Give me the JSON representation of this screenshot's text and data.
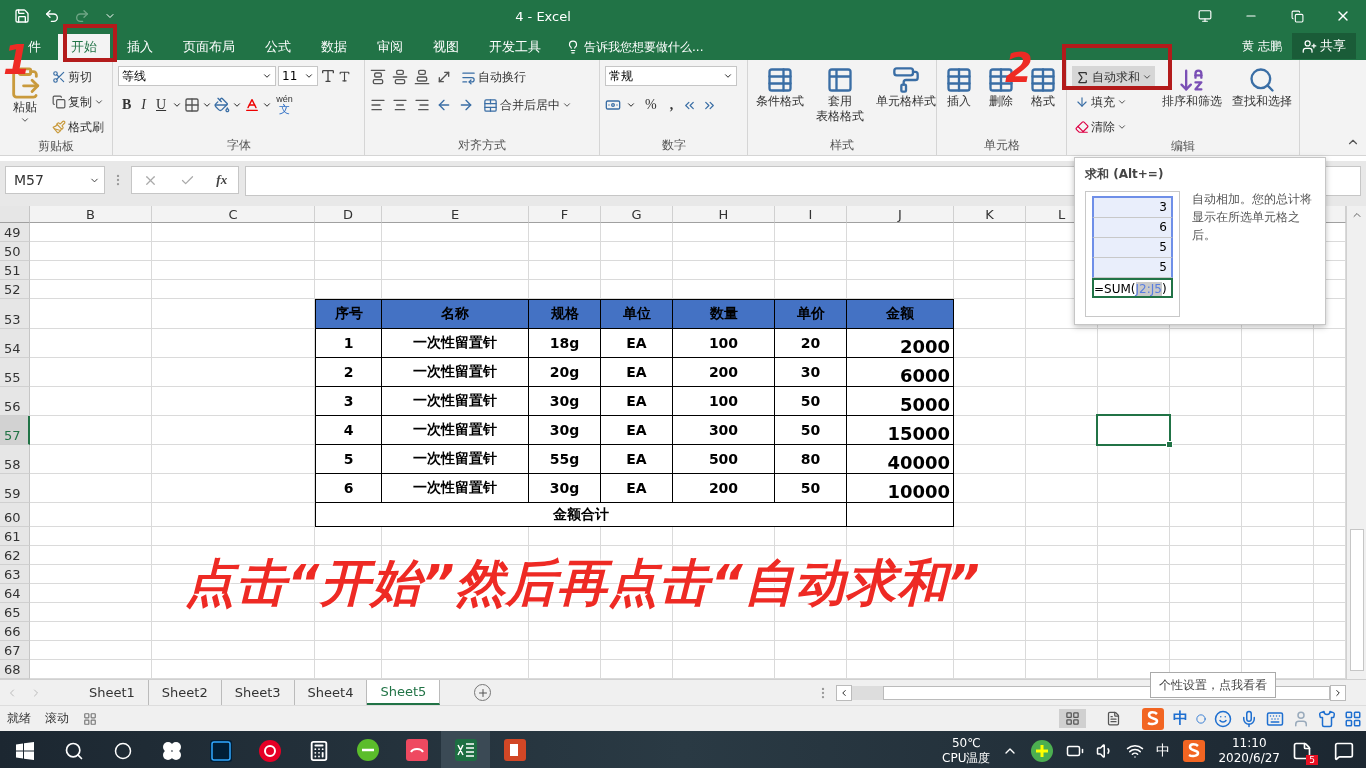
{
  "window": {
    "title": "4 - Excel"
  },
  "ribbon_tabs": [
    {
      "label": "件",
      "selected": false
    },
    {
      "label": "开始",
      "selected": true
    },
    {
      "label": "插入",
      "selected": false
    },
    {
      "label": "页面布局",
      "selected": false
    },
    {
      "label": "公式",
      "selected": false
    },
    {
      "label": "数据",
      "selected": false
    },
    {
      "label": "审阅",
      "selected": false
    },
    {
      "label": "视图",
      "selected": false
    },
    {
      "label": "开发工具",
      "selected": false
    }
  ],
  "tell_me": {
    "placeholder": "告诉我您想要做什么..."
  },
  "account": {
    "user": "黄 志鹏",
    "share": "共享"
  },
  "ribbon": {
    "clipboard": {
      "label": "剪贴板",
      "paste": "粘贴",
      "cut": "剪切",
      "copy": "复制",
      "format_painter": "格式刷"
    },
    "font": {
      "label": "字体",
      "font_name": "等线",
      "font_size": "11",
      "bold": "B",
      "italic": "I",
      "underline": "U",
      "phonetic_top": "wén",
      "phonetic_bottom": "文"
    },
    "alignment": {
      "label": "对齐方式",
      "wrap_text": "自动换行",
      "merge_center": "合并后居中"
    },
    "number": {
      "label": "数字",
      "format": "常规",
      "percent": "%",
      "comma": ","
    },
    "styles": {
      "label": "样式",
      "buttons": [
        {
          "lines": [
            "条件格式"
          ]
        },
        {
          "lines": [
            "套用",
            "表格格式"
          ]
        },
        {
          "lines": [
            "单元格样式"
          ]
        }
      ]
    },
    "cells": {
      "label": "单元格",
      "buttons": [
        "插入",
        "删除",
        "格式"
      ]
    },
    "editing": {
      "label": "编辑",
      "autosum": "自动求和",
      "fill": "填充",
      "clear": "清除",
      "sort_filter": "排序和筛选",
      "find_select": "查找和选择"
    }
  },
  "formula_bar": {
    "name_box": "M57",
    "function_label": "fx"
  },
  "sheet": {
    "columns": [
      "B",
      "C",
      "D",
      "E",
      "F",
      "G",
      "H",
      "I",
      "J",
      "K",
      "L"
    ],
    "rows": [
      {
        "number": "49",
        "selected": false
      },
      {
        "number": "50",
        "selected": false
      },
      {
        "number": "51",
        "selected": false
      },
      {
        "number": "52",
        "selected": false
      },
      {
        "number": "53",
        "selected": false
      },
      {
        "number": "54",
        "selected": false
      },
      {
        "number": "55",
        "selected": false
      },
      {
        "number": "56",
        "selected": false
      },
      {
        "number": "57",
        "selected": true
      },
      {
        "number": "58",
        "selected": false
      },
      {
        "number": "59",
        "selected": false
      },
      {
        "number": "60",
        "selected": false
      },
      {
        "number": "61",
        "selected": false
      },
      {
        "number": "62",
        "selected": false
      },
      {
        "number": "63",
        "selected": false
      },
      {
        "number": "64",
        "selected": false
      },
      {
        "number": "65",
        "selected": false
      },
      {
        "number": "66",
        "selected": false
      },
      {
        "number": "67",
        "selected": false
      },
      {
        "number": "68",
        "selected": false
      }
    ],
    "table": {
      "header": [
        "序号",
        "名称",
        "规格",
        "单位",
        "数量",
        "单价",
        "金额"
      ],
      "rows": [
        [
          "1",
          "一次性留置针",
          "18g",
          "EA",
          "100",
          "20",
          "2000"
        ],
        [
          "2",
          "一次性留置针",
          "20g",
          "EA",
          "200",
          "30",
          "6000"
        ],
        [
          "3",
          "一次性留置针",
          "30g",
          "EA",
          "100",
          "50",
          "5000"
        ],
        [
          "4",
          "一次性留置针",
          "30g",
          "EA",
          "300",
          "50",
          "15000"
        ],
        [
          "5",
          "一次性留置针",
          "55g",
          "EA",
          "500",
          "80",
          "40000"
        ],
        [
          "6",
          "一次性留置针",
          "30g",
          "EA",
          "200",
          "50",
          "10000"
        ]
      ],
      "total_label": "金额合计"
    }
  },
  "tooltip": {
    "title": "求和 (Alt+=)",
    "description": "自动相加。您的总计将显示在所选单元格之后。",
    "example_values": [
      "3",
      "6",
      "5",
      "5"
    ],
    "formula": {
      "prefix": "=SUM(",
      "range": "J2:J5",
      "suffix": ")"
    }
  },
  "sheet_tabs": [
    {
      "label": "Sheet1",
      "selected": false
    },
    {
      "label": "Sheet2",
      "selected": false
    },
    {
      "label": "Sheet3",
      "selected": false
    },
    {
      "label": "Sheet4",
      "selected": false
    },
    {
      "label": "Sheet5",
      "selected": true
    }
  ],
  "status_bar": {
    "items": [
      "就绪",
      "滚动"
    ]
  },
  "ime": {
    "popup": "个性设置，点我看看",
    "mode": "中"
  },
  "taskbar": {
    "temperature": "50℃",
    "temperature_label": "CPU温度",
    "input_mode": "中",
    "time": "11:10",
    "date": "2020/6/27",
    "notification_count": "5"
  },
  "annotations": {
    "step_1": "1",
    "step_2": "2",
    "caption": "点击“开始”然后再点击“自动求和”"
  }
}
